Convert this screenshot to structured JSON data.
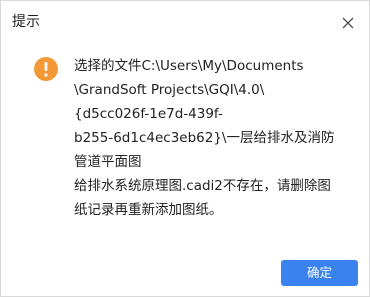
{
  "dialog": {
    "title": "提示",
    "icon": "warning-icon",
    "accent_color": "#f29836",
    "message_lines": [
      "选择的文件C:\\Users\\My\\Documents",
      "\\GrandSoft Projects\\GQI\\4.0\\",
      "{d5cc026f-1e7d-439f-",
      "b255-6d1c4ec3eb62}\\一层给排水及消防",
      "管道平面图",
      "给排水系统原理图.cadi2不存在，请删除图",
      "纸记录再重新添加图纸。"
    ],
    "ok_label": "确定",
    "ok_color": "#3a82ee"
  }
}
